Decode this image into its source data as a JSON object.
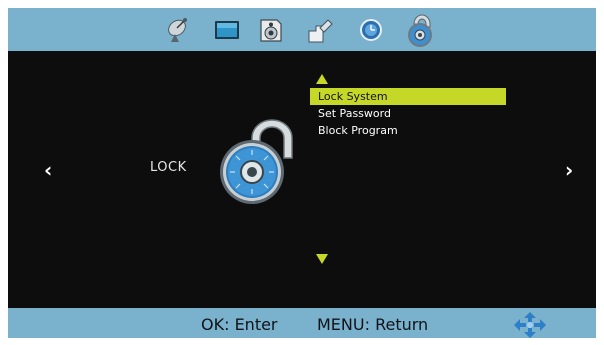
{
  "top_tabs": [
    {
      "icon": "satellite-dish-icon"
    },
    {
      "icon": "picture-icon"
    },
    {
      "icon": "sound-icon"
    },
    {
      "icon": "settings-icon"
    },
    {
      "icon": "time-icon"
    },
    {
      "icon": "lock-icon",
      "active": true
    }
  ],
  "page": {
    "title": "LOCK",
    "prev": "‹",
    "next": "›"
  },
  "menu": {
    "items": [
      {
        "label": "Lock System",
        "selected": true
      },
      {
        "label": "Set Password"
      },
      {
        "label": "Block Program"
      }
    ]
  },
  "footer": {
    "ok_hint": "OK: Enter",
    "menu_hint": "MENU: Return"
  },
  "colors": {
    "bar": "#7ab1cd",
    "highlight": "#c6d827",
    "background": "#0d0d0d"
  }
}
